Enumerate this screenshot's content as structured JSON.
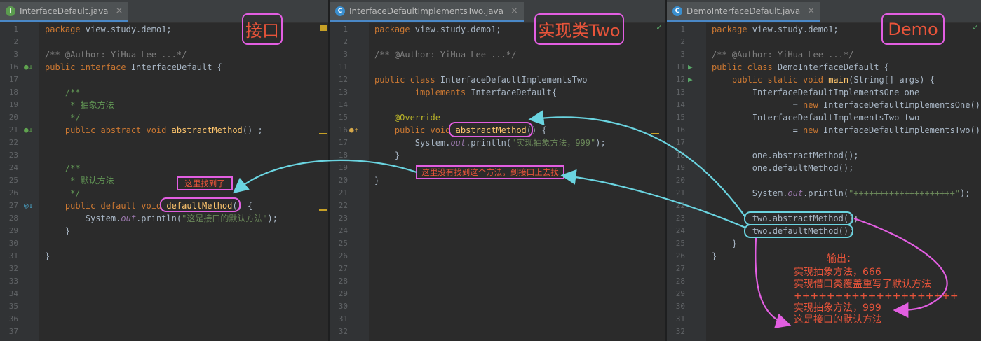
{
  "panes": [
    {
      "tab": {
        "icon": "interface-file-icon",
        "icon_letter": "I",
        "title": "InterfaceDefault.java",
        "close": "×"
      },
      "label": "接口",
      "lines": [
        {
          "n": "1",
          "html": "<span class=\"kw\">package</span> view.study.demo1;"
        },
        {
          "n": "2",
          "html": ""
        },
        {
          "n": "3",
          "html": "<span class=\"cmi\">/** @Author: YiHua Lee ...*/</span>"
        },
        {
          "n": "16",
          "html": "<span class=\"kw\">public interface</span> InterfaceDefault {"
        },
        {
          "n": "17",
          "html": ""
        },
        {
          "n": "18",
          "html": "    <span class=\"cm\">/**</span>"
        },
        {
          "n": "19",
          "html": "<span class=\"cm\">     * 抽象方法</span>"
        },
        {
          "n": "20",
          "html": "<span class=\"cm\">     */</span>"
        },
        {
          "n": "21",
          "html": "    <span class=\"kw\">public abstract void</span> <span class=\"fn\">abstractMethod</span>() ;"
        },
        {
          "n": "22",
          "html": ""
        },
        {
          "n": "23",
          "html": ""
        },
        {
          "n": "24",
          "html": "    <span class=\"cm\">/**</span>"
        },
        {
          "n": "25",
          "html": "<span class=\"cm\">     * 默认方法</span>"
        },
        {
          "n": "26",
          "html": "<span class=\"cm\">     */</span>"
        },
        {
          "n": "27",
          "html": "    <span class=\"kw\">public default void</span> <span class=\"fn\">defaultMethod</span>() {"
        },
        {
          "n": "28",
          "html": "        System.<span class=\"it\">out</span>.println(<span class=\"str\">\"这是接口的默认方法\"</span>);"
        },
        {
          "n": "29",
          "html": "    }"
        },
        {
          "n": "30",
          "html": ""
        },
        {
          "n": "31",
          "html": "}"
        },
        {
          "n": "32",
          "html": ""
        },
        {
          "n": "33",
          "html": ""
        },
        {
          "n": "34",
          "html": ""
        },
        {
          "n": "35",
          "html": ""
        },
        {
          "n": "36",
          "html": ""
        },
        {
          "n": "37",
          "html": ""
        }
      ],
      "note": "这里找到了"
    },
    {
      "tab": {
        "icon": "class-file-icon",
        "icon_letter": "C",
        "title": "InterfaceDefaultImplementsTwo.java",
        "close": "×"
      },
      "label": "实现类Two",
      "lines": [
        {
          "n": "1",
          "html": "<span class=\"kw\">package</span> view.study.demo1;"
        },
        {
          "n": "2",
          "html": ""
        },
        {
          "n": "3",
          "html": "<span class=\"cmi\">/** @Author: YiHua Lee ...*/</span>"
        },
        {
          "n": "11",
          "html": ""
        },
        {
          "n": "12",
          "html": "<span class=\"kw\">public class</span> InterfaceDefaultImplementsTwo"
        },
        {
          "n": "13",
          "html": "        <span class=\"kw\">implements</span> InterfaceDefault{"
        },
        {
          "n": "14",
          "html": ""
        },
        {
          "n": "15",
          "html": "    <span class=\"ann\">@Override</span>"
        },
        {
          "n": "16",
          "html": "    <span class=\"kw\">public void</span> <span class=\"fn\">abstractMethod</span>() {"
        },
        {
          "n": "17",
          "html": "        System.<span class=\"it\">out</span>.println(<span class=\"str\">\"实现抽象方法，999\"</span>);"
        },
        {
          "n": "18",
          "html": "    }"
        },
        {
          "n": "19",
          "html": ""
        },
        {
          "n": "20",
          "html": "}"
        },
        {
          "n": "21",
          "html": ""
        },
        {
          "n": "22",
          "html": ""
        },
        {
          "n": "23",
          "html": ""
        },
        {
          "n": "24",
          "html": ""
        },
        {
          "n": "25",
          "html": ""
        },
        {
          "n": "26",
          "html": ""
        },
        {
          "n": "27",
          "html": ""
        },
        {
          "n": "28",
          "html": ""
        },
        {
          "n": "29",
          "html": ""
        },
        {
          "n": "30",
          "html": ""
        },
        {
          "n": "31",
          "html": ""
        },
        {
          "n": "32",
          "html": ""
        }
      ],
      "note": "这里没有找到这个方法，到接口上去找"
    },
    {
      "tab": {
        "icon": "runnable-class-file-icon",
        "icon_letter": "C",
        "title": "DemoInterfaceDefault.java",
        "close": "×"
      },
      "label": "Demo",
      "lines": [
        {
          "n": "1",
          "html": "<span class=\"kw\">package</span> view.study.demo1;"
        },
        {
          "n": "2",
          "html": ""
        },
        {
          "n": "3",
          "html": "<span class=\"cmi\">/** @Author: YiHua Lee ...*/</span>"
        },
        {
          "n": "11",
          "html": "<span class=\"kw\">public class</span> DemoInterfaceDefault {"
        },
        {
          "n": "12",
          "html": "    <span class=\"kw\">public static void</span> <span class=\"fn\">main</span>(String[] args) {"
        },
        {
          "n": "13",
          "html": "        InterfaceDefaultImplementsOne one"
        },
        {
          "n": "14",
          "html": "                = <span class=\"kw\">new</span> InterfaceDefaultImplementsOne();"
        },
        {
          "n": "15",
          "html": "        InterfaceDefaultImplementsTwo two"
        },
        {
          "n": "16",
          "html": "                = <span class=\"kw\">new</span> InterfaceDefaultImplementsTwo();"
        },
        {
          "n": "17",
          "html": ""
        },
        {
          "n": "18",
          "html": "        one.abstractMethod();"
        },
        {
          "n": "19",
          "html": "        one.defaultMethod();"
        },
        {
          "n": "20",
          "html": ""
        },
        {
          "n": "21",
          "html": "        System.<span class=\"it\">out</span>.println(<span class=\"str\">\"++++++++++++++++++++\"</span>);"
        },
        {
          "n": "22",
          "html": ""
        },
        {
          "n": "23",
          "html": "        two.abstractMethod();"
        },
        {
          "n": "24",
          "html": "        two.defaultMethod();"
        },
        {
          "n": "25",
          "html": "    }"
        },
        {
          "n": "26",
          "html": "}"
        },
        {
          "n": "27",
          "html": ""
        },
        {
          "n": "28",
          "html": ""
        },
        {
          "n": "29",
          "html": ""
        },
        {
          "n": "30",
          "html": ""
        },
        {
          "n": "31",
          "html": ""
        },
        {
          "n": "32",
          "html": ""
        }
      ],
      "output": {
        "heading": "输出：",
        "lines": [
          "实现抽象方法，666",
          "实现借口类覆盖重写了默认方法",
          "++++++++++++++++++++",
          "实现抽象方法，999",
          "这是接口的默认方法"
        ]
      }
    }
  ],
  "colors": {
    "annotation": "#e25ee1",
    "arrow_cyan": "#6ad4e0",
    "note_text": "#e9543a",
    "editor_bg": "#2b2b2b"
  }
}
